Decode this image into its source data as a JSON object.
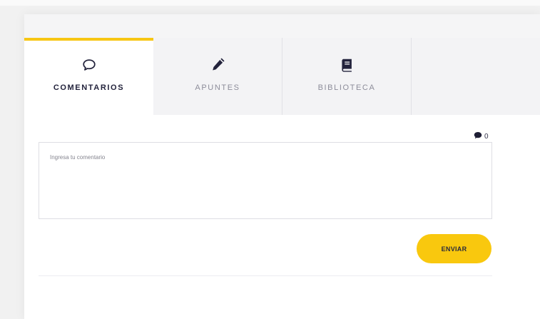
{
  "tabs": [
    {
      "label": "COMENTARIOS",
      "icon": "speech-bubble-icon",
      "active": true
    },
    {
      "label": "APUNTES",
      "icon": "pencil-icon",
      "active": false
    },
    {
      "label": "BIBLIOTECA",
      "icon": "book-icon",
      "active": false
    }
  ],
  "comments": {
    "count": "0",
    "placeholder": "Ingresa tu comentario",
    "value": ""
  },
  "actions": {
    "send_label": "ENVIAR"
  },
  "colors": {
    "accent": "#f9c80e",
    "text_dark": "#23233c",
    "text_muted": "#8d8d9a"
  }
}
